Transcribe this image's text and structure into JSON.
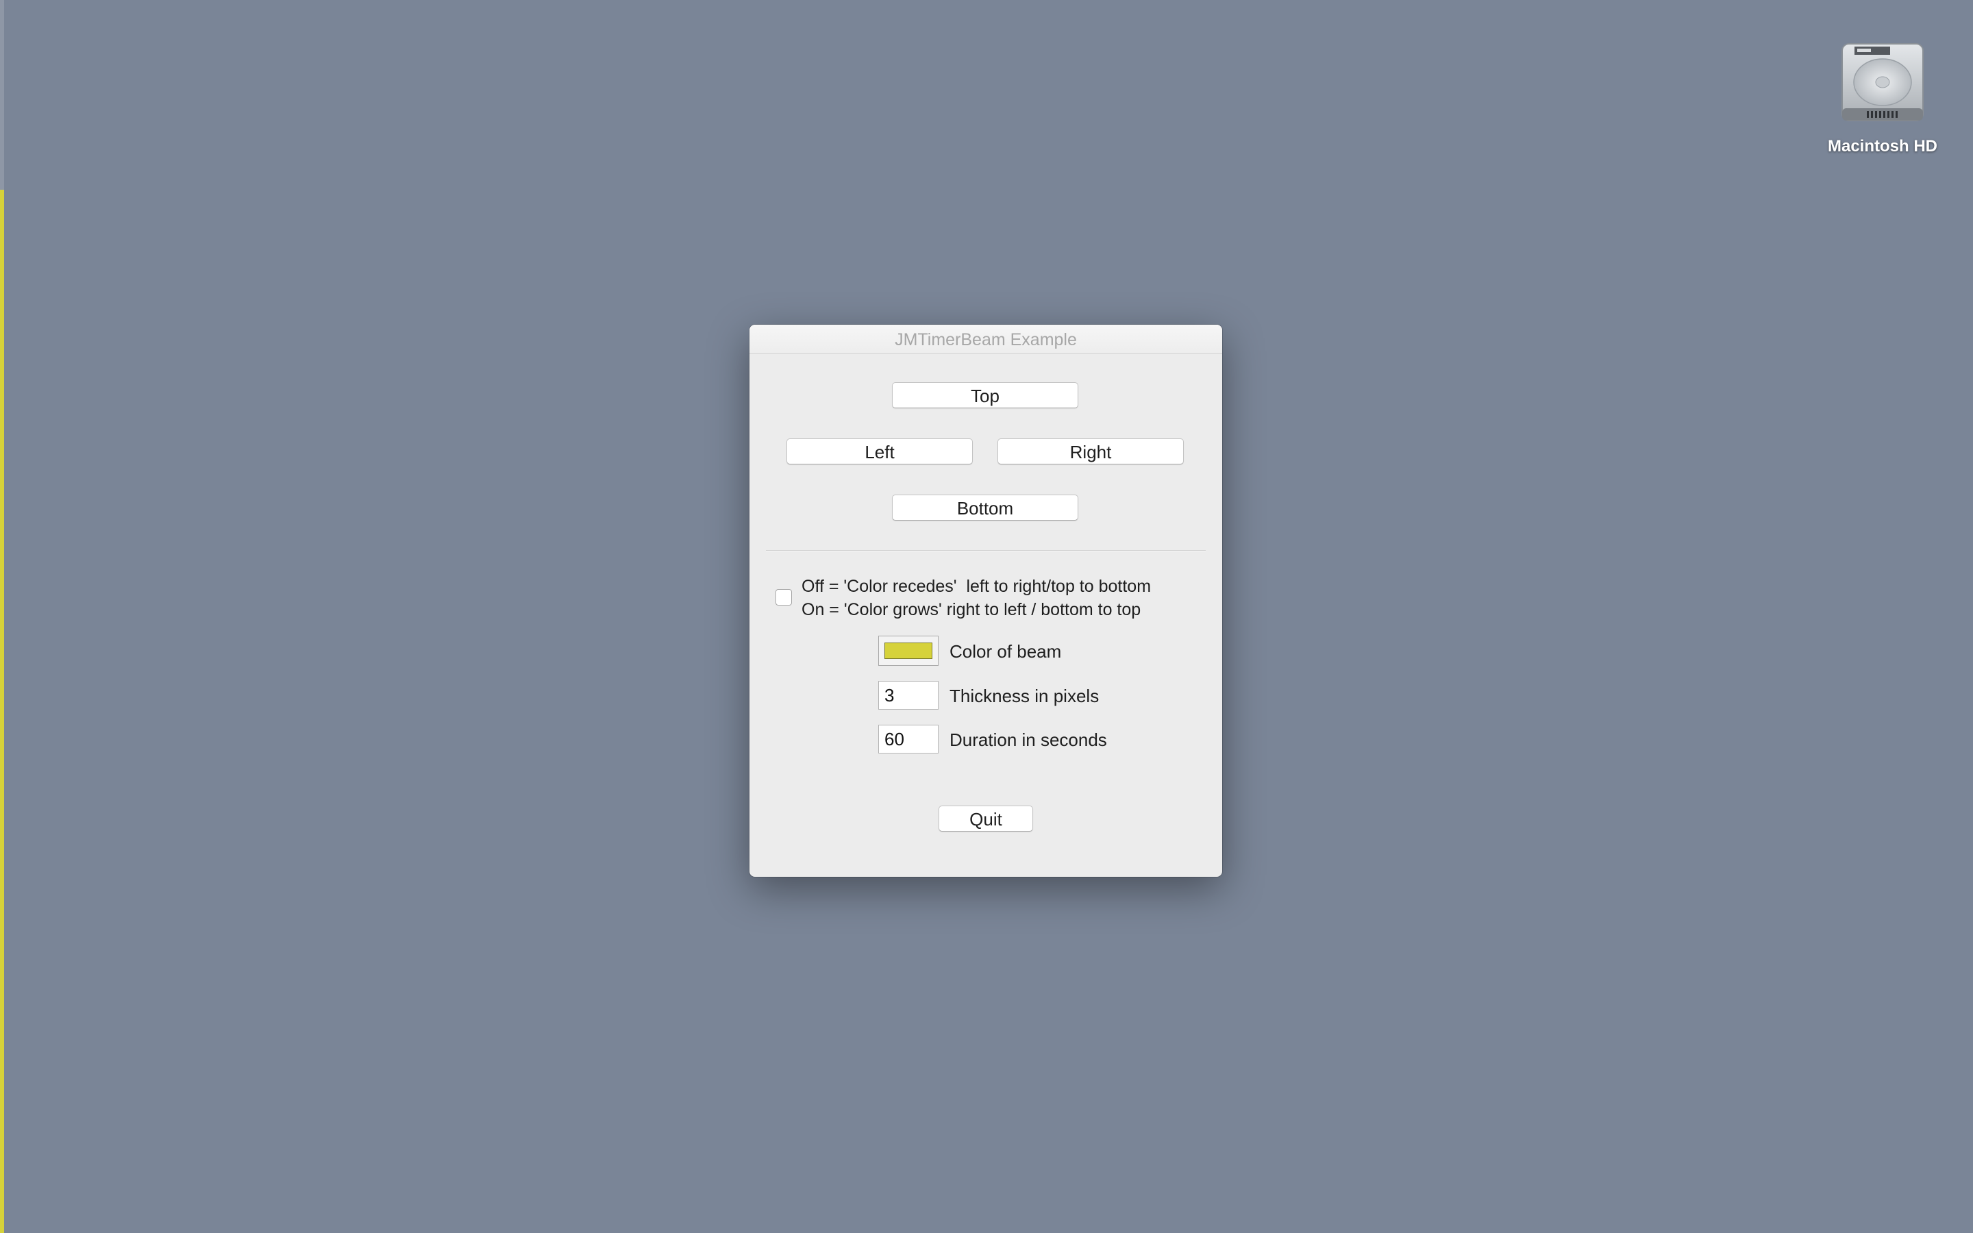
{
  "desktop": {
    "background": "#7a8597",
    "beam_color": "#d6d23a",
    "beam_progress": 0.846,
    "icons": [
      {
        "label": "Macintosh HD",
        "icon": "hard-drive-icon"
      }
    ]
  },
  "window": {
    "title": "JMTimerBeam Example",
    "buttons": {
      "top": "Top",
      "left": "Left",
      "right": "Right",
      "bottom": "Bottom",
      "quit": "Quit"
    },
    "direction_checkbox": {
      "checked": false,
      "line1": "Off = 'Color recedes'  left to right/top to bottom",
      "line2": "On = 'Color grows' right to left / bottom to top"
    },
    "beam_color": {
      "label": "Color of beam",
      "value": "#d6d23a"
    },
    "thickness": {
      "label": "Thickness in pixels",
      "value": "3"
    },
    "duration": {
      "label": "Duration in seconds",
      "value": "60"
    }
  }
}
